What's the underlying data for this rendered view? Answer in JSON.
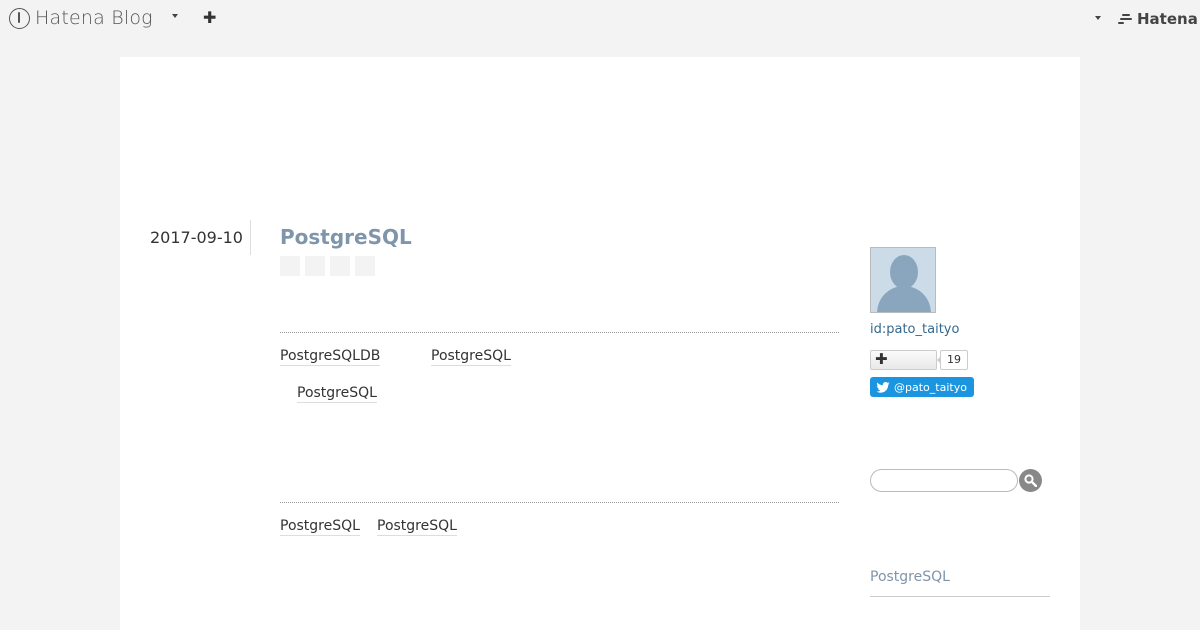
{
  "header": {
    "logo_text": "Hatena Blog",
    "hatena_text": "Hatena"
  },
  "entry": {
    "date": "2017-09-10",
    "title": "PostgreSQL",
    "body_links_row1": [
      "PostgreSQLDB",
      "PostgreSQL"
    ],
    "body_links_row2": [
      "PostgreSQL"
    ],
    "footer_links": [
      "PostgreSQL",
      "PostgreSQL"
    ]
  },
  "sidebar": {
    "user_id": "id:pato_taityo",
    "subscriber_count": "19",
    "twitter_handle": "@pato_taityo",
    "search_placeholder": "",
    "category_title": "PostgreSQL"
  },
  "colors": {
    "page_bg": "#f3f3f3",
    "title_link": "#7f95aa",
    "user_link": "#35688f",
    "twitter_blue": "#1b95e0"
  }
}
